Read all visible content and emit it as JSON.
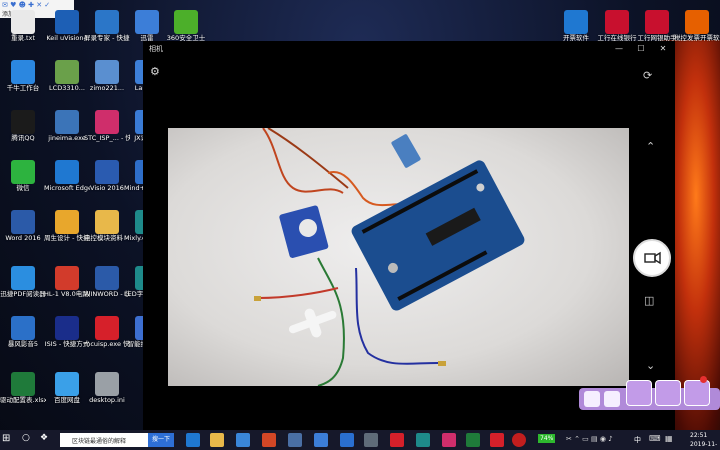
{
  "desktop": {
    "icons": [
      {
        "id": "recycle",
        "label": "重录.txt",
        "color": "#e9e9e9"
      },
      {
        "id": "keil",
        "label": "Keil uVision4",
        "color": "#1d5fb5"
      },
      {
        "id": "screen",
        "label": "屏录专家 - 快捷方式",
        "color": "#2b76c8"
      },
      {
        "id": "xunlei",
        "label": "迅雷",
        "color": "#3c7ed8"
      },
      {
        "id": "360",
        "label": "360安全卫士",
        "color": "#4caf2a"
      },
      {
        "id": "wenda",
        "label": "千牛工作台",
        "color": "#2b87e0"
      },
      {
        "id": "lcd",
        "label": "LCD3310...",
        "color": "#6aa04a"
      },
      {
        "id": "zimo",
        "label": "zimo221...",
        "color": "#5a8fd0"
      },
      {
        "id": "lantern",
        "label": "Lante...",
        "color": "#3d7fd8"
      },
      {
        "id": "qq",
        "label": "腾讯QQ",
        "color": "#1b1b1b"
      },
      {
        "id": "jineima",
        "label": "jineima.exe",
        "color": "#3b74b8"
      },
      {
        "id": "stc",
        "label": "STC_ISP_... - 快捷方式",
        "color": "#cf2e6b"
      },
      {
        "id": "jx",
        "label": "JX识智...",
        "color": "#3a7bd5"
      },
      {
        "id": "wechat",
        "label": "微信",
        "color": "#2db33f"
      },
      {
        "id": "edge",
        "label": "Microsoft Edge",
        "color": "#1f78d1"
      },
      {
        "id": "visio",
        "label": "Visio 2016",
        "color": "#2a5bb0"
      },
      {
        "id": "mind",
        "label": "Mind+ 快捷方式",
        "color": "#2e6ec9"
      },
      {
        "id": "word",
        "label": "Word 2016",
        "color": "#2b5aa8"
      },
      {
        "id": "design",
        "label": "周生设计 - 快捷方式",
        "color": "#e8a72c"
      },
      {
        "id": "folder",
        "label": "电控模块资料 - 快捷方式",
        "color": "#e8b84a"
      },
      {
        "id": "mixly",
        "label": "Mixly.exe 快捷方式",
        "color": "#1e8a8a"
      },
      {
        "id": "pdf",
        "label": "迅捷PDF阅读器",
        "color": "#2b8ee0"
      },
      {
        "id": "hl",
        "label": "HL-1 V8.0电路图.pdf",
        "color": "#d23b2b"
      },
      {
        "id": "winword",
        "label": "WINWORD - 快捷方式",
        "color": "#2b5aa8"
      },
      {
        "id": "led",
        "label": "LED字幕 - 快捷方式",
        "color": "#1e8a8a"
      },
      {
        "id": "flash",
        "label": "暴风影音5",
        "color": "#2b70c8"
      },
      {
        "id": "isis",
        "label": "ISIS - 快捷方式",
        "color": "#1a2d8a"
      },
      {
        "id": "mcuisp",
        "label": "mcuisp.exe 快捷方式",
        "color": "#d6202a"
      },
      {
        "id": "maoji",
        "label": "智能控制线.E",
        "color": "#3d6fd0"
      },
      {
        "id": "config",
        "label": "驱动配置表.xlsx",
        "color": "#1f7a3a"
      },
      {
        "id": "cloud",
        "label": "百度网盘",
        "color": "#3aa0e8"
      },
      {
        "id": "ini",
        "label": "desktop.ini",
        "color": "#9aa0a6"
      }
    ],
    "right_icons": [
      {
        "id": "kaipiao",
        "label": "开票软件",
        "color": "#1f78d1"
      },
      {
        "id": "icbc",
        "label": "工行在线银行",
        "color": "#c8102e"
      },
      {
        "id": "icbc2",
        "label": "工行网银助手",
        "color": "#c8102e"
      },
      {
        "id": "firefox",
        "label": "税控发票开票软件(金税...",
        "color": "#e66000"
      }
    ],
    "top_toolbar_label": "添加到看看"
  },
  "camera": {
    "title": "相机",
    "minimize": "—",
    "maximize": "☐",
    "close": "✕"
  },
  "taskbar": {
    "search_text": "区块链最通俗的解释",
    "search_button": "搜一下",
    "battery": "74%",
    "ime": "中",
    "time": "22:51",
    "date": "2019-11-"
  }
}
